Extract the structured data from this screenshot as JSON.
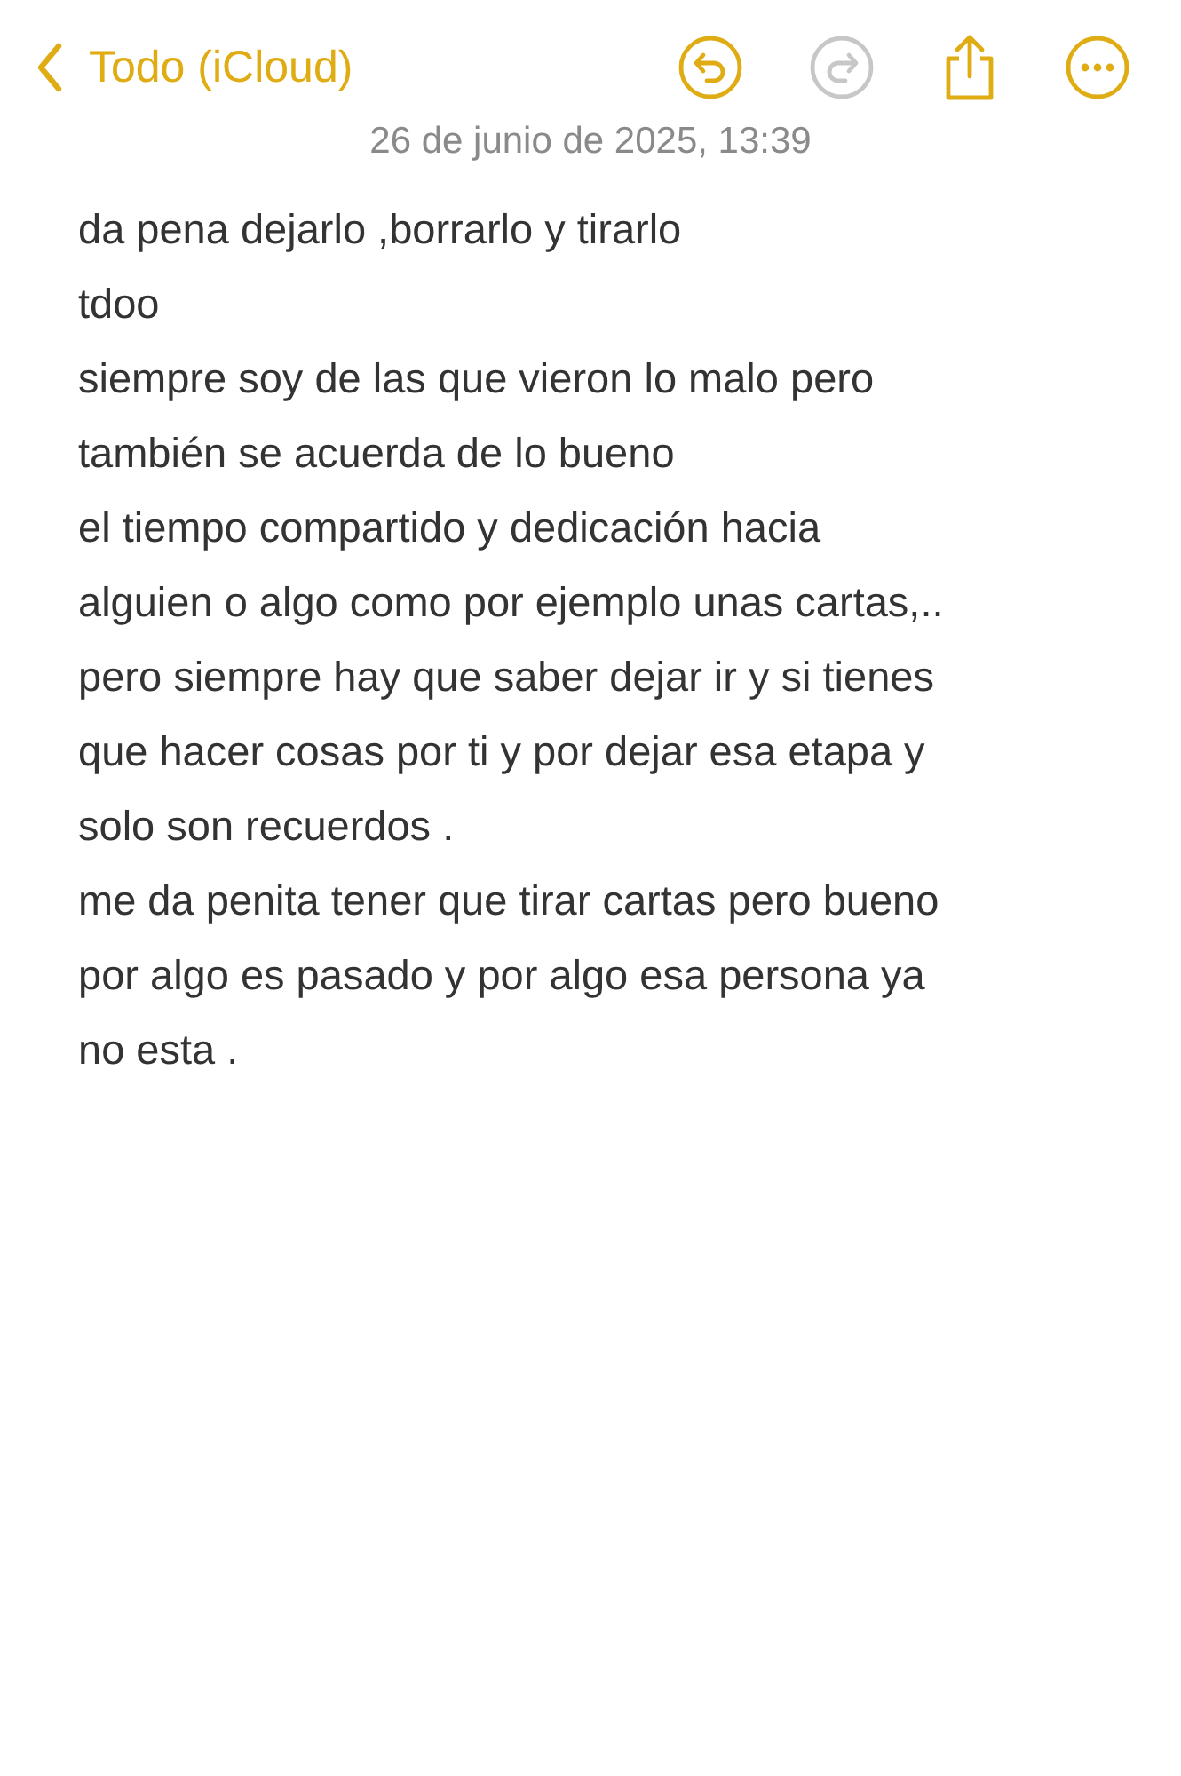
{
  "nav": {
    "back_label": "Todo (iCloud)"
  },
  "toolbar": [
    {
      "kind": "undo",
      "disabled": false
    },
    {
      "kind": "redo",
      "disabled": true
    },
    {
      "kind": "share",
      "disabled": false
    },
    {
      "kind": "more",
      "disabled": false
    }
  ],
  "note": {
    "date": "26 de junio de 2025, 13:39",
    "lines": [
      "da pena dejarlo ,borrarlo y tirarlo",
      "tdoo",
      "siempre soy de las que vieron lo malo pero",
      "también se acuerda de lo bueno",
      "el tiempo compartido y dedicación hacia",
      "alguien o algo como por ejemplo unas cartas,..",
      "pero siempre hay que saber dejar ir y si tienes",
      "que hacer cosas por ti y por dejar esa etapa y",
      "solo son recuerdos .",
      "me da penita tener que tirar cartas pero bueno",
      "por algo es pasado y por algo esa persona ya",
      "no esta ."
    ]
  }
}
